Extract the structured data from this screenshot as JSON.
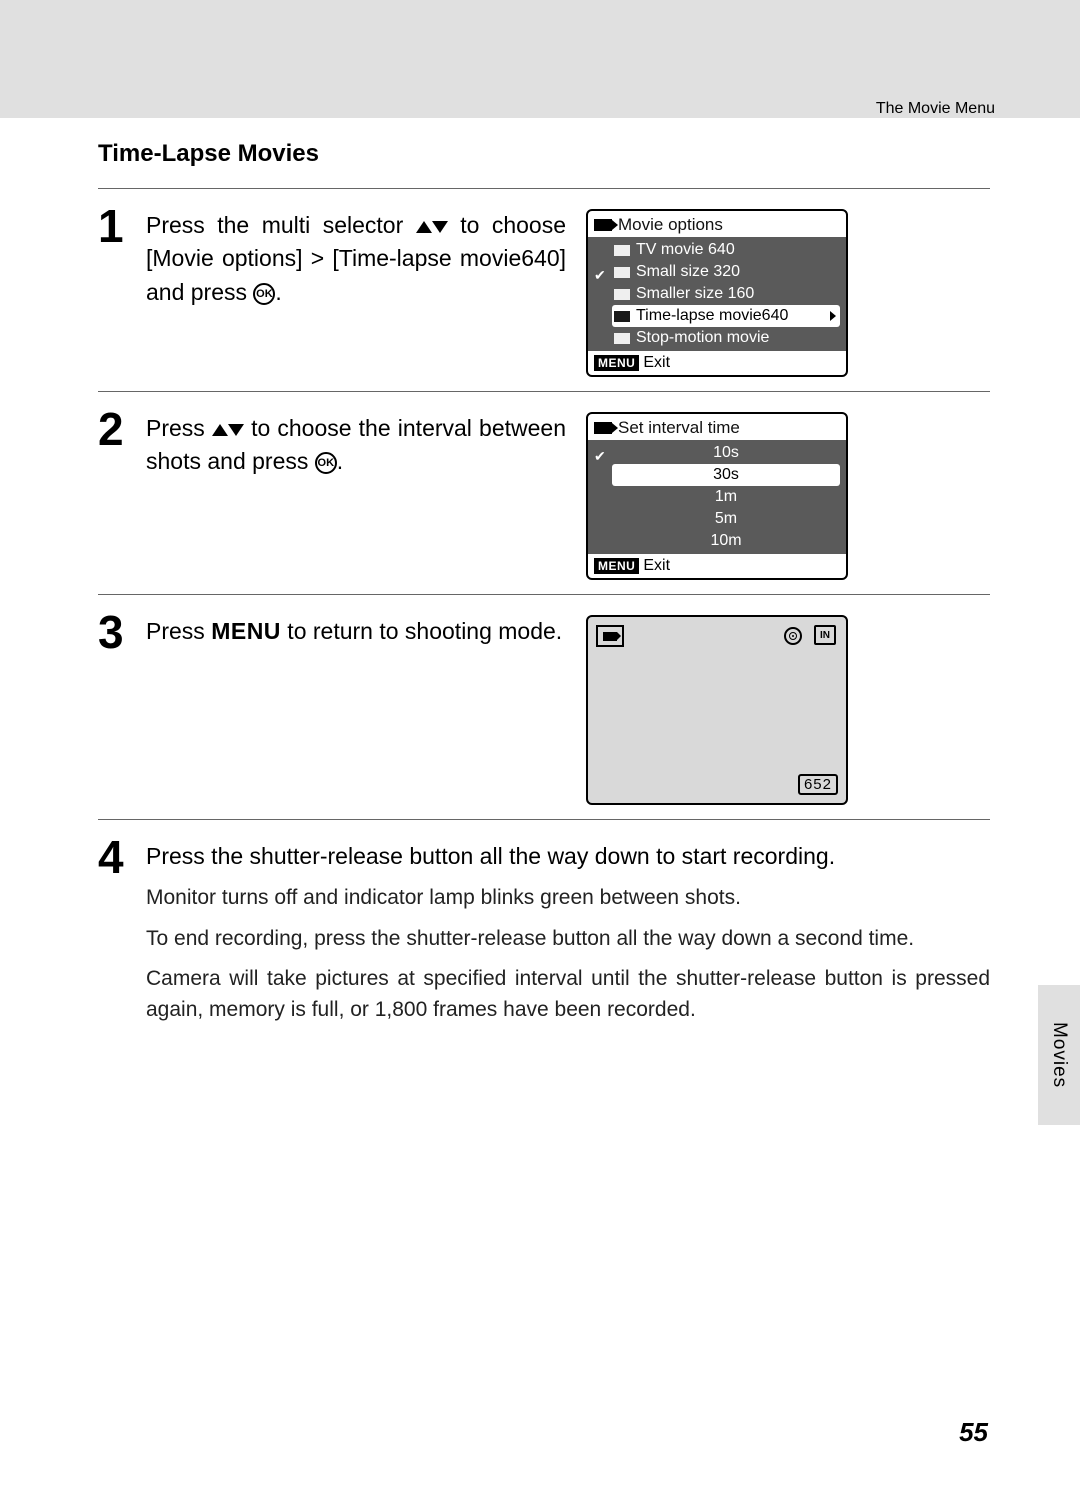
{
  "header": {
    "title": "The Movie Menu"
  },
  "section_title": "Time-Lapse Movies",
  "side_tab": "Movies",
  "steps": {
    "s1": {
      "num": "1",
      "text_pre": "Press the multi selector ",
      "text_mid": " to choose [Movie options] > [Time-lapse movie640] and press ",
      "text_post": "."
    },
    "s2": {
      "num": "2",
      "text_pre": "Press ",
      "text_mid": " to choose the interval between shots and press ",
      "text_post": "."
    },
    "s3": {
      "num": "3",
      "text_pre": "Press ",
      "menu_word": "MENU",
      "text_post": " to return to shooting mode."
    },
    "s4": {
      "num": "4",
      "line1": "Press the shutter-release button all the way down to start recording.",
      "p1": "Monitor turns off and indicator lamp blinks green between shots.",
      "p2": "To end recording, press the shutter-release button all the way down a second time.",
      "p3": "Camera will take pictures at specified interval until the shutter-release button is pressed again, memory is full, or 1,800 frames have been recorded."
    }
  },
  "screen1": {
    "title": "Movie options",
    "items": [
      "TV movie 640",
      "Small size 320",
      "Smaller size 160",
      "Time-lapse movie640",
      "Stop-motion movie"
    ],
    "selected_index": 3,
    "footer_menu": "MENU",
    "footer_exit": "Exit"
  },
  "screen2": {
    "title": "Set interval time",
    "items": [
      "10s",
      "30s",
      "1m",
      "5m",
      "10m"
    ],
    "selected_index": 1,
    "footer_menu": "MENU",
    "footer_exit": "Exit"
  },
  "screen3": {
    "mem_label": "IN",
    "rec_count": "652"
  },
  "ok_label": "OK",
  "page_number": "55"
}
